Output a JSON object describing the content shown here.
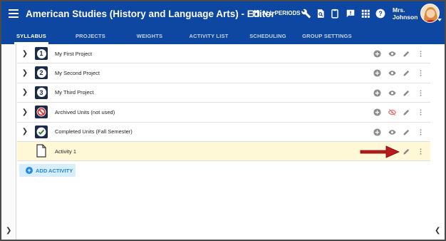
{
  "app": {
    "title": "American Studies (History and Language Arts) - Editor",
    "periods_label": "ALL PERIODS",
    "user_name_line1": "Mrs.",
    "user_name_line2": "Johnson",
    "accent_color": "#0d47a1"
  },
  "toolbar_icons": [
    "calendar-icon",
    "wrench-icon",
    "search-document-icon",
    "clipboard-icon",
    "feedback-icon",
    "apps-grid-icon",
    "help-icon"
  ],
  "tabs": [
    {
      "label": "SYLLABUS",
      "active": true
    },
    {
      "label": "PROJECTS",
      "active": false
    },
    {
      "label": "WEIGHTS",
      "active": false
    },
    {
      "label": "ACTIVITY LIST",
      "active": false
    },
    {
      "label": "SCHEDULING",
      "active": false
    },
    {
      "label": "GROUP SETTINGS",
      "active": false
    }
  ],
  "rows": [
    {
      "label": "My First Project",
      "badge": "1",
      "icon": "number-badge-icon",
      "expandable": true
    },
    {
      "label": "My Second Project",
      "badge": "2",
      "icon": "number-badge-icon",
      "expandable": true
    },
    {
      "label": "My Third Project",
      "badge": "3",
      "icon": "number-badge-icon",
      "expandable": true
    },
    {
      "label": "Archived Units (not used)",
      "icon": "prohibited-icon",
      "expandable": true,
      "hidden": true
    },
    {
      "label": "Completed Units (Fall Semester)",
      "icon": "check-circle-icon",
      "expandable": true
    },
    {
      "label": "Activity 1",
      "icon": "document-icon",
      "expandable": false,
      "highlighted": true
    }
  ],
  "add_button": {
    "label": "ADD ACTIVITY"
  }
}
